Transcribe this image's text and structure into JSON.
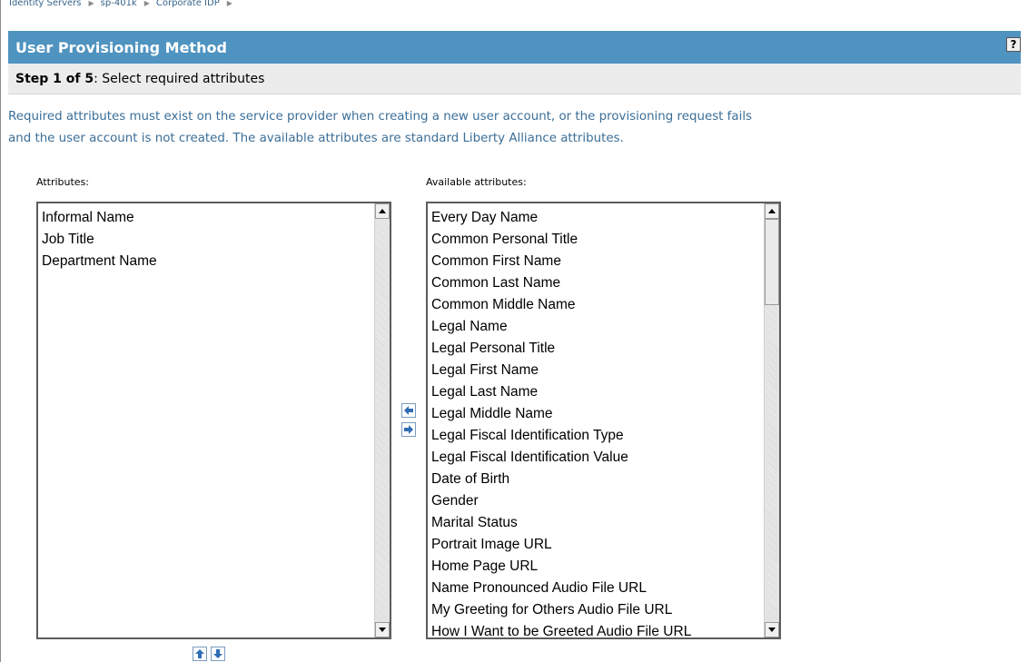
{
  "breadcrumb": [
    "Identity Servers",
    "sp-401k",
    "Corporate IDP"
  ],
  "header": {
    "title": "User Provisioning Method",
    "help_label": "?"
  },
  "step": {
    "prefix": "Step 1 of 5",
    "text": ": Select required attributes"
  },
  "description": {
    "line1": "Required attributes must exist on the service provider when creating a new user account, or the provisioning request fails",
    "line2": "and the user account is not created. The available attributes are standard Liberty Alliance attributes."
  },
  "attributes": {
    "label": "Attributes:",
    "items": [
      "Informal Name",
      "Job Title",
      "Department Name"
    ]
  },
  "available": {
    "label": "Available attributes:",
    "items": [
      "Every Day Name",
      "Common Personal Title",
      "Common First Name",
      "Common Last Name",
      "Common Middle Name",
      "Legal Name",
      "Legal Personal Title",
      "Legal First Name",
      "Legal Last Name",
      "Legal Middle Name",
      "Legal Fiscal Identification Type",
      "Legal Fiscal Identification Value",
      "Date of Birth",
      "Gender",
      "Marital Status",
      "Portrait Image URL",
      "Home Page URL",
      "Name Pronounced Audio File URL",
      "My Greeting for Others Audio File URL",
      "How I Want to be Greeted Audio File URL"
    ]
  },
  "icons": {
    "move_left": "arrow-left-icon",
    "move_right": "arrow-right-icon",
    "move_up": "arrow-up-icon",
    "move_down": "arrow-down-icon"
  },
  "colors": {
    "header_bg": "#4f93c0",
    "description_text": "#3a6e98",
    "arrow_blue": "#2f6db5"
  }
}
